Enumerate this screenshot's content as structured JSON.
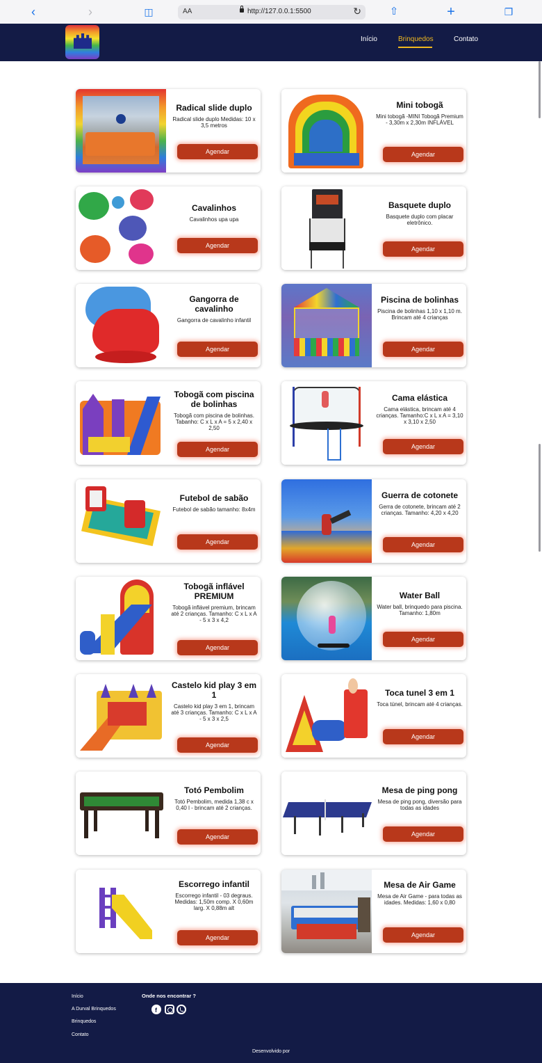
{
  "browser": {
    "text_size": "AA",
    "url": "http://127.0.0.1:5500"
  },
  "nav": {
    "home": "Início",
    "toys": "Brinquedos",
    "contact": "Contato"
  },
  "cards": [
    {
      "title": "Radical slide duplo",
      "desc": "Radical slide duplo Medidas: 10 x 3,5 metros",
      "button": "Agendar"
    },
    {
      "title": "Mini tobogã",
      "desc": "Mini tobogã -MINI Tobogã Premium - 3,30m x 2,30m INFLÁVEL",
      "button": "Agendar"
    },
    {
      "title": "Cavalinhos",
      "desc": "Cavalinhos upa upa",
      "button": "Agendar"
    },
    {
      "title": "Basquete duplo",
      "desc": "Basquete duplo com placar eletrônico.",
      "button": "Agendar"
    },
    {
      "title": "Gangorra de cavalinho",
      "desc": "Gangorra de cavalinho infantil",
      "button": "Agendar"
    },
    {
      "title": "Piscina de bolinhas",
      "desc": "Piscina de bolinhas 1,10 x 1,10 m. Brincam até 4 crianças",
      "button": "Agendar"
    },
    {
      "title": "Tobogã com piscina de bolinhas",
      "desc": "Tobogã com piscina de bolinhas. Tabanho: C x L x A = 5 x 2,40 x 2,50",
      "button": "Agendar"
    },
    {
      "title": "Cama elástica",
      "desc": "Cama elástica, brincam até 4 crianças. Tamanho:C x L x A = 3,10 x 3,10 x 2,50",
      "button": "Agendar"
    },
    {
      "title": "Futebol de sabão",
      "desc": "Futebol de sabão tamanho: 8x4m",
      "button": "Agendar"
    },
    {
      "title": "Guerra de cotonete",
      "desc": "Gerra de cotonete, brincam até 2 crianças. Tamanho: 4,20 x 4,20",
      "button": "Agendar"
    },
    {
      "title": "Tobogã inflável PREMIUM",
      "desc": "Tobogã inflável premium, brincam até 2 crianças. Tamanho: C x L x A - 5 x 3 x 4,2",
      "button": "Agendar"
    },
    {
      "title": "Water Ball",
      "desc": "Water ball, brinquedo para piscina. Tamanho: 1,80m",
      "button": "Agendar"
    },
    {
      "title": "Castelo kid play 3 em 1",
      "desc": "Castelo kid play 3 em 1, brincam até 3 crianças. Tamanho: C x L x A - 5 x 3 x 2,5",
      "button": "Agendar"
    },
    {
      "title": "Toca tunel 3 em 1",
      "desc": "Toca túnel, brincam até 4 crianças.",
      "button": "Agendar"
    },
    {
      "title": "Totó Pembolim",
      "desc": "Totó Pembolim, medida 1,38 c x 0,40 l - brincam até 2 crianças.",
      "button": "Agendar"
    },
    {
      "title": "Mesa de ping pong",
      "desc": "Mesa de ping pong, diversão para todas as idades",
      "button": "Agendar"
    },
    {
      "title": "Escorrego infantil",
      "desc": "Escorrego infantil - 03 degraus. Medidas: 1,50m comp. X 0,60m larg. X 0,88m alt",
      "button": "Agendar"
    },
    {
      "title": "Mesa de Air Game",
      "desc": "Mesa de Air Game - para todas as idades. Medidas: 1,60 x 0,80",
      "button": "Agendar"
    }
  ],
  "footer": {
    "links": [
      "Início",
      "A Durval Brinquedos",
      "Brinquedos",
      "Contato"
    ],
    "find_us": "Onde nos encontrar ?",
    "developed_by": "Desenvolvido por"
  }
}
